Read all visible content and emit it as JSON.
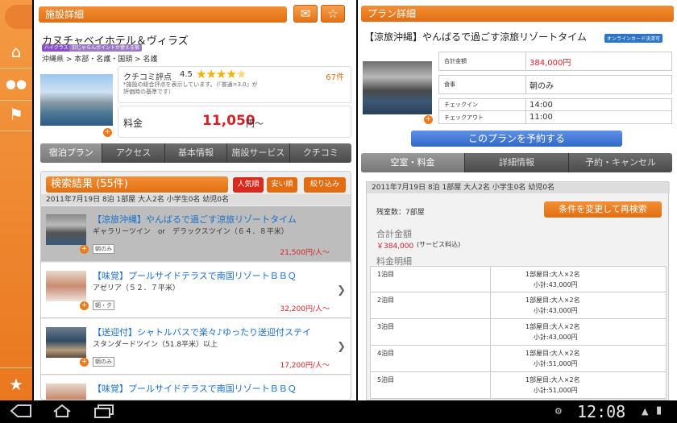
{
  "sidebar": {
    "icons": [
      "home-icon",
      "binoculars-icon",
      "flag-icon",
      "star-icon"
    ]
  },
  "left": {
    "header": "施設詳細",
    "hotel_name": "カヌチャベイホテル＆ヴィラズ",
    "badges": [
      "ハイクラス",
      "旧じゃらんポイントが使える宿"
    ],
    "location": "沖縄県 > 本部・名護・国頭 > 名護",
    "review_label": "クチコミ評点",
    "review_score": "4.5",
    "review_count": "67件",
    "review_note": "*施設の総合評点を表示しています。（『普通=3.0』が評価時の基準です）",
    "rating": 4.5,
    "price_label": "料金",
    "price_value": "11,050",
    "price_suffix": "円～",
    "tabs": [
      "宿泊プラン",
      "アクセス",
      "基本情報",
      "施設サービス",
      "クチコミ"
    ]
  },
  "results": {
    "title": "検索結果 (55件)",
    "sort_popular": "人気順",
    "sort_cheap": "安い順",
    "filter": "絞り込み",
    "condition": "2011年7月19日 8泊 1部屋 大人2名 小学生0名 幼児0名",
    "items": [
      {
        "title": "【涼旅沖縄】やんばるで過ごす涼旅リゾートタイム",
        "room": "ギャラリーツイン　or　デラックスツイン（６４．８平米）",
        "meal": "朝のみ",
        "price": "21,500円/人～"
      },
      {
        "title": "【味覚】プールサイドテラスで南国リゾートＢＢＱ",
        "room": "アゼリア（５２．７平米）",
        "meal": "朝・夕",
        "price": "32,200円/人～"
      },
      {
        "title": "【送迎付】シャトルバスで楽々♪ゆったり送迎付ステイ",
        "room": "スタンダードツイン（51.8平米）以上",
        "meal": "朝のみ",
        "price": "17,200円/人～"
      },
      {
        "title": "【味覚】プールサイドテラスで南国リゾートＢＢＱ",
        "room": "",
        "meal": "",
        "price": ""
      }
    ]
  },
  "right": {
    "header": "プラン詳細",
    "plan_title": "【涼旅沖縄】やんばるで過ごす涼旅リゾートタイム",
    "plan_badge": "オンラインカード決済可",
    "total_label": "合計金額",
    "total_value": "384,000円",
    "meal_label": "食事",
    "meal_value": "朝のみ",
    "checkin_label": "チェックイン",
    "checkin_value": "14:00",
    "checkout_label": "チェックアウト",
    "checkout_value": "11:00",
    "reserve_button": "このプランを予約する",
    "tabs": [
      "空室・料金",
      "詳細情報",
      "予約・キャンセル"
    ],
    "condition": "2011年7月19日 8泊 1部屋 大人2名 小学生0名 幼児0名",
    "rooms_left": "残室数：7部屋",
    "change_button": "条件を変更して再検索",
    "total_amount_label": "合計金額",
    "total_amount": "￥384,000",
    "total_amount_note": "(サービス料込)",
    "breakdown_label": "料金明細",
    "nights": [
      {
        "night": "1泊目",
        "detail": "1部屋目:大人×2名",
        "subtotal": "小計:43,000円"
      },
      {
        "night": "2泊目",
        "detail": "1部屋目:大人×2名",
        "subtotal": "小計:43,000円"
      },
      {
        "night": "3泊目",
        "detail": "1部屋目:大人×2名",
        "subtotal": "小計:43,000円"
      },
      {
        "night": "4泊目",
        "detail": "1部屋目:大人×2名",
        "subtotal": "小計:51,000円"
      },
      {
        "night": "5泊目",
        "detail": "1部屋目:大人×2名",
        "subtotal": "小計:51,000円"
      }
    ]
  },
  "system": {
    "clock": "12:08"
  }
}
